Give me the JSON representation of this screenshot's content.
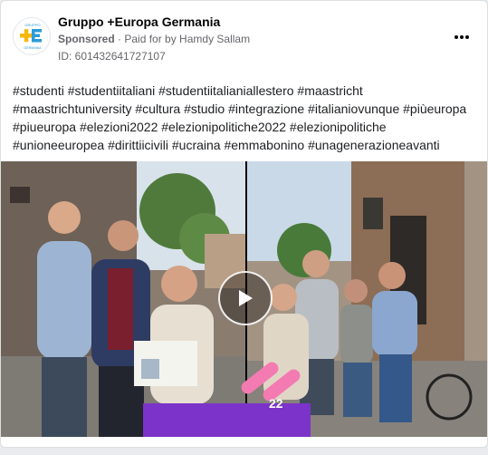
{
  "post": {
    "page_name": "Gruppo +Europa Germania",
    "sponsored_label": "Sponsored",
    "paid_for": "Paid for by Hamdy Sallam",
    "ad_id": "ID: 601432641727107",
    "caption_lines": [
      "#studenti #studentiitaliani #studentiitalianiallestero #maastricht",
      "#maastrichtuniversity #cultura #studio #integrazione #italianiovunque #piùeuropa",
      "#piueuropa #elezioni2022 #elezionipolitiche2022 #elezionipolitiche",
      "#unioneeuropea #dirittiicivili #ucraina #emmabonino #unagenerazioneavanti"
    ]
  },
  "avatar": {
    "logo_text_top": "GRUPPO",
    "logo_text_bottom": "GERMANIA"
  },
  "video": {
    "poster_badge": "22"
  },
  "colors": {
    "brand_yellow": "#f5b70f",
    "brand_blue": "#2b9bd7",
    "overlay_purple": "#7c33c9",
    "overlay_pink": "#f47ab2"
  },
  "icons": {
    "more": "more-horizontal-icon",
    "play": "play-icon"
  }
}
